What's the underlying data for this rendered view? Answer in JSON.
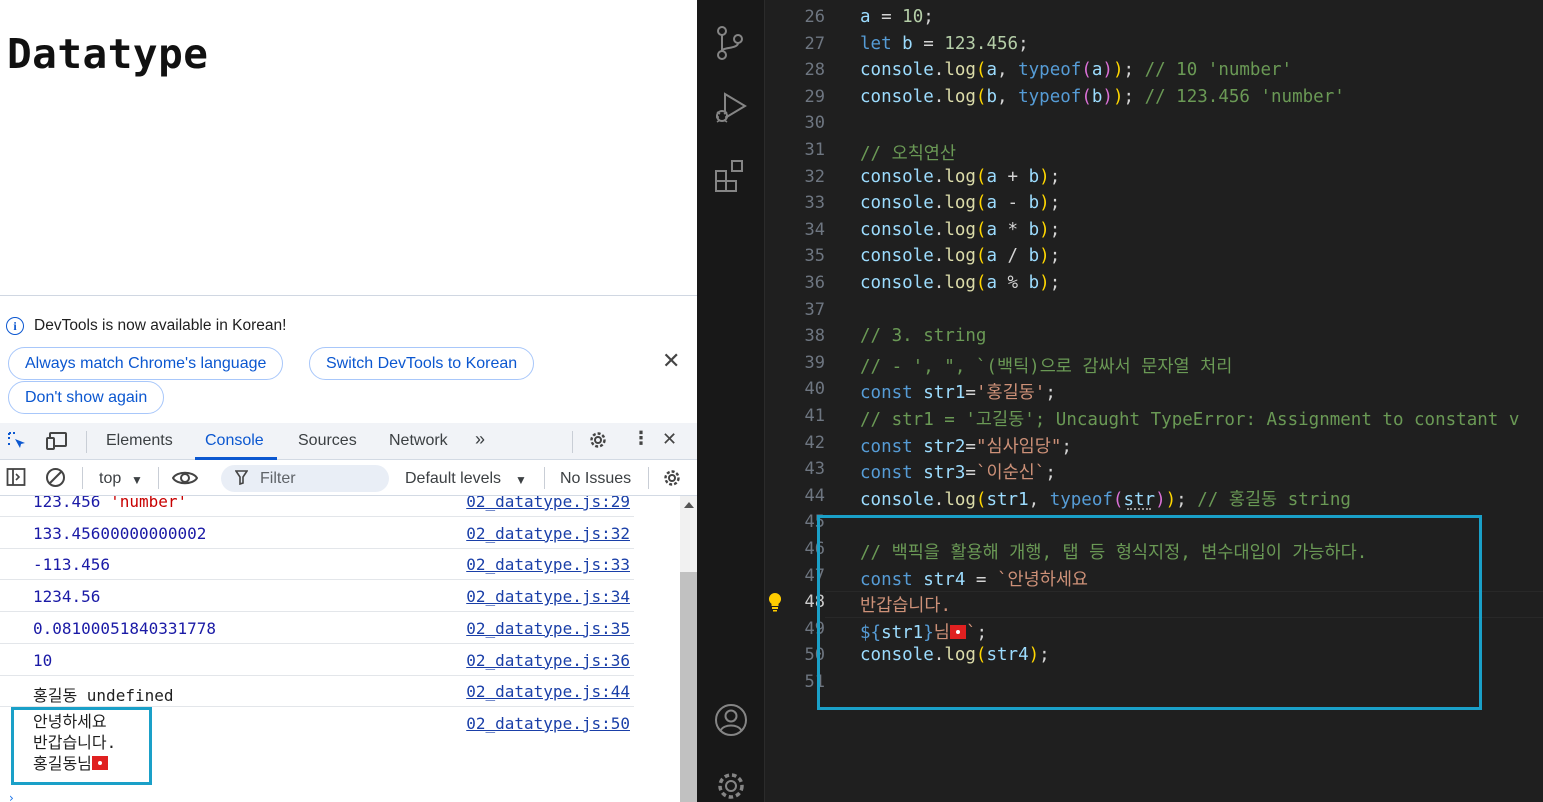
{
  "browser_page": {
    "heading": "Datatype"
  },
  "devtools": {
    "notice": {
      "text": "DevTools is now available in Korean!",
      "buttons": [
        "Always match Chrome's language",
        "Switch DevTools to Korean",
        "Don't show again"
      ]
    },
    "tabs": [
      "Elements",
      "Console",
      "Sources",
      "Network"
    ],
    "active_tab": "Console",
    "toolbar": {
      "context": "top",
      "filter_placeholder": "Filter",
      "levels": "Default levels",
      "issues": "No Issues"
    },
    "console_rows": [
      {
        "value": "123.456 ",
        "string": "'number'",
        "source": "02_datatype.js:29",
        "kind": "number"
      },
      {
        "value": "133.45600000000002",
        "source": "02_datatype.js:32",
        "kind": "number"
      },
      {
        "value": "-113.456",
        "source": "02_datatype.js:33",
        "kind": "number"
      },
      {
        "value": "1234.56",
        "source": "02_datatype.js:34",
        "kind": "number"
      },
      {
        "value": "0.08100051840331778",
        "source": "02_datatype.js:35",
        "kind": "number"
      },
      {
        "value": "10",
        "source": "02_datatype.js:36",
        "kind": "number"
      },
      {
        "value": "홍길동 undefined",
        "source": "02_datatype.js:44",
        "kind": "plain"
      },
      {
        "lines": [
          "안녕하세요",
          "반갑습니다.",
          "홍길동님"
        ],
        "source": "02_datatype.js:50",
        "kind": "multiline"
      }
    ]
  },
  "editor": {
    "lines": [
      {
        "n": "26",
        "html": "<span class='v'>a</span> = <span class='n'>10</span>;"
      },
      {
        "n": "27",
        "html": "<span class='k'>let</span> <span class='v'>b</span> = <span class='n'>123.456</span>;"
      },
      {
        "n": "28",
        "html": "<span class='v'>console</span>.<span class='f'>log</span><span class='y'>(</span><span class='v'>a</span>, <span class='k'>typeof</span><span class='pp'>(</span><span class='v'>a</span><span class='pp'>)</span><span class='y'>)</span>; <span class='c'>// 10 'number'</span>"
      },
      {
        "n": "29",
        "html": "<span class='v'>console</span>.<span class='f'>log</span><span class='y'>(</span><span class='v'>b</span>, <span class='k'>typeof</span><span class='pp'>(</span><span class='v'>b</span><span class='pp'>)</span><span class='y'>)</span>; <span class='c'>// 123.456 'number'</span>"
      },
      {
        "n": "30",
        "html": ""
      },
      {
        "n": "31",
        "html": "<span class='c'>// 오칙연산</span>"
      },
      {
        "n": "32",
        "html": "<span class='v'>console</span>.<span class='f'>log</span><span class='y'>(</span><span class='v'>a</span> + <span class='v'>b</span><span class='y'>)</span>;"
      },
      {
        "n": "33",
        "html": "<span class='v'>console</span>.<span class='f'>log</span><span class='y'>(</span><span class='v'>a</span> - <span class='v'>b</span><span class='y'>)</span>;"
      },
      {
        "n": "34",
        "html": "<span class='v'>console</span>.<span class='f'>log</span><span class='y'>(</span><span class='v'>a</span> * <span class='v'>b</span><span class='y'>)</span>;"
      },
      {
        "n": "35",
        "html": "<span class='v'>console</span>.<span class='f'>log</span><span class='y'>(</span><span class='v'>a</span> / <span class='v'>b</span><span class='y'>)</span>;"
      },
      {
        "n": "36",
        "html": "<span class='v'>console</span>.<span class='f'>log</span><span class='y'>(</span><span class='v'>a</span> % <span class='v'>b</span><span class='y'>)</span>;"
      },
      {
        "n": "37",
        "html": ""
      },
      {
        "n": "38",
        "html": "<span class='c'>// 3. string</span>"
      },
      {
        "n": "39",
        "html": "<span class='c'>// - ', \", `(백틱)으로 감싸서 문자열 처리</span>"
      },
      {
        "n": "40",
        "html": "<span class='k'>const</span> <span class='v'>str1</span>=<span class='s'>'홍길동'</span>;"
      },
      {
        "n": "41",
        "html": "<span class='c'>// str1 = '고길동'; Uncaught TypeError: Assignment to constant v</span>"
      },
      {
        "n": "42",
        "html": "<span class='k'>const</span> <span class='v'>str2</span>=<span class='s'>\"심사임당\"</span>;"
      },
      {
        "n": "43",
        "html": "<span class='k'>const</span> <span class='v'>str3</span>=<span class='s'>`이순신`</span>;"
      },
      {
        "n": "44",
        "html": "<span class='v'>console</span>.<span class='f'>log</span><span class='y'>(</span><span class='v'>str1</span>, <span class='k'>typeof</span><span class='pp'>(</span><span class='v'>str</span><span class='pp'>)</span><span class='y'>)</span>; <span class='c'>// 홍길동 string</span>"
      },
      {
        "n": "45",
        "html": ""
      },
      {
        "n": "46",
        "html": "<span class='c'>// 백픽을 활용해 개행, 탭 등 형식지정, 변수대입이 가능하다.</span>"
      },
      {
        "n": "47",
        "html": "<span class='k'>const</span> <span class='v'>str4</span> = <span class='s'>`안녕하세요</span>"
      },
      {
        "n": "48",
        "html": "<span class='s'>반갑습니다.</span>"
      },
      {
        "n": "49",
        "html": "<span class='k'>${</span><span class='v'>str1</span><span class='k'>}</span><span class='s'>님</span><span class='flag'></span><span class='s'>`</span>;"
      },
      {
        "n": "50",
        "html": "<span class='v'>console</span>.<span class='f'>log</span><span class='y'>(</span><span class='v'>str4</span><span class='y'>)</span>;"
      },
      {
        "n": "51",
        "html": ""
      }
    ],
    "current_line": "48"
  }
}
